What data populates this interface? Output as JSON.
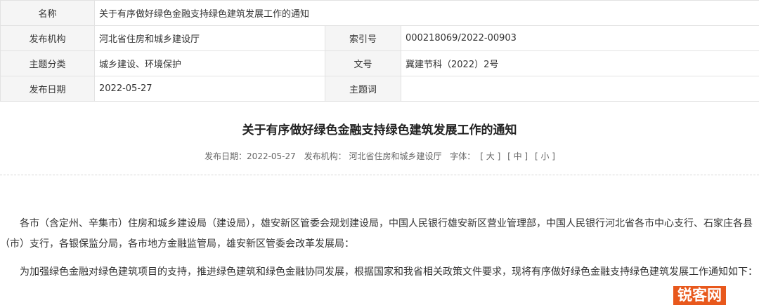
{
  "meta": {
    "name_label": "名称",
    "name_value": "关于有序做好绿色金融支持绿色建筑发展工作的通知",
    "agency_label": "发布机构",
    "agency_value": "河北省住房和城乡建设厅",
    "index_label": "索引号",
    "index_value": "000218069/2022-00903",
    "topic_label": "主题分类",
    "topic_value": "城乡建设、环境保护",
    "docno_label": "文号",
    "docno_value": "冀建节科（2022）2号",
    "date_label": "发布日期",
    "date_value": "2022-05-27",
    "keyword_label": "主题词",
    "keyword_value": ""
  },
  "article": {
    "title": "关于有序做好绿色金融支持绿色建筑发展工作的通知",
    "info_date": "发布日期：2022-05-27",
    "info_agency": "发布机构： 河北省住房和城乡建设厅",
    "font_label": "字体：",
    "font_large": "[ 大 ]",
    "font_medium": "[ 中 ]",
    "font_small": "[ 小 ]",
    "para1": "各市（含定州、辛集市）住房和城乡建设局（建设局），雄安新区管委会规划建设局，中国人民银行雄安新区营业管理部，中国人民银行河北省各市中心支行、石家庄各县（市）支行，各银保监分局，各市地方金融监管局，雄安新区管委会改革发展局：",
    "para2": "为加强绿色金融对绿色建筑项目的支持，推进绿色建筑和绿色金融协同发展，根据国家和我省相关政策文件要求，现将有序做好绿色金融支持绿色建筑发展工作通知如下："
  },
  "watermark": {
    "text": "锐客网",
    "color": "#e8581c"
  }
}
